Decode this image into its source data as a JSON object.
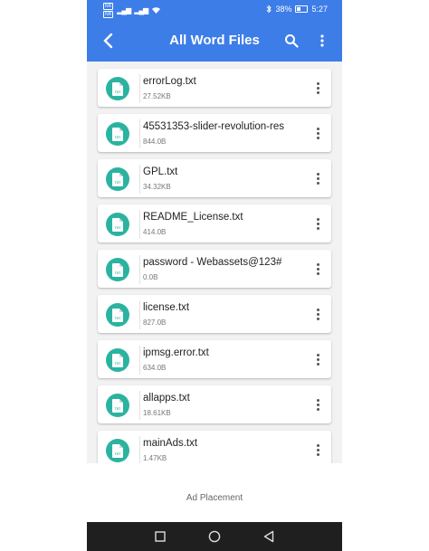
{
  "status_bar": {
    "battery": "38%",
    "time": "5:27",
    "sim1": "NR",
    "sim2": "NR"
  },
  "app_bar": {
    "title": "All Word Files",
    "back_icon": "back-arrow-icon",
    "search_icon": "search-icon",
    "menu_icon": "overflow-menu-icon"
  },
  "files": [
    {
      "name": "errorLog.txt",
      "size": "27.52KB",
      "icon_label": "TXT"
    },
    {
      "name": "45531353-slider-revolution-res",
      "size": "844.0B",
      "icon_label": "TXT"
    },
    {
      "name": "GPL.txt",
      "size": "34.32KB",
      "icon_label": "TXT"
    },
    {
      "name": "README_License.txt",
      "size": "414.0B",
      "icon_label": "TXT"
    },
    {
      "name": "password - Webassets@123#",
      "size": "0.0B",
      "icon_label": "TXT"
    },
    {
      "name": "license.txt",
      "size": "827.0B",
      "icon_label": "TXT"
    },
    {
      "name": "ipmsg.error.txt",
      "size": "634.0B",
      "icon_label": "TXT"
    },
    {
      "name": "allapps.txt",
      "size": "18.61KB",
      "icon_label": "TXT"
    },
    {
      "name": "mainAds.txt",
      "size": "1.47KB",
      "icon_label": "TXT"
    }
  ],
  "ad": {
    "label": "Ad Placement"
  },
  "colors": {
    "accent": "#3d7de8",
    "file_icon": "#2bb3a0",
    "nav_bar": "#1f1f1f"
  }
}
